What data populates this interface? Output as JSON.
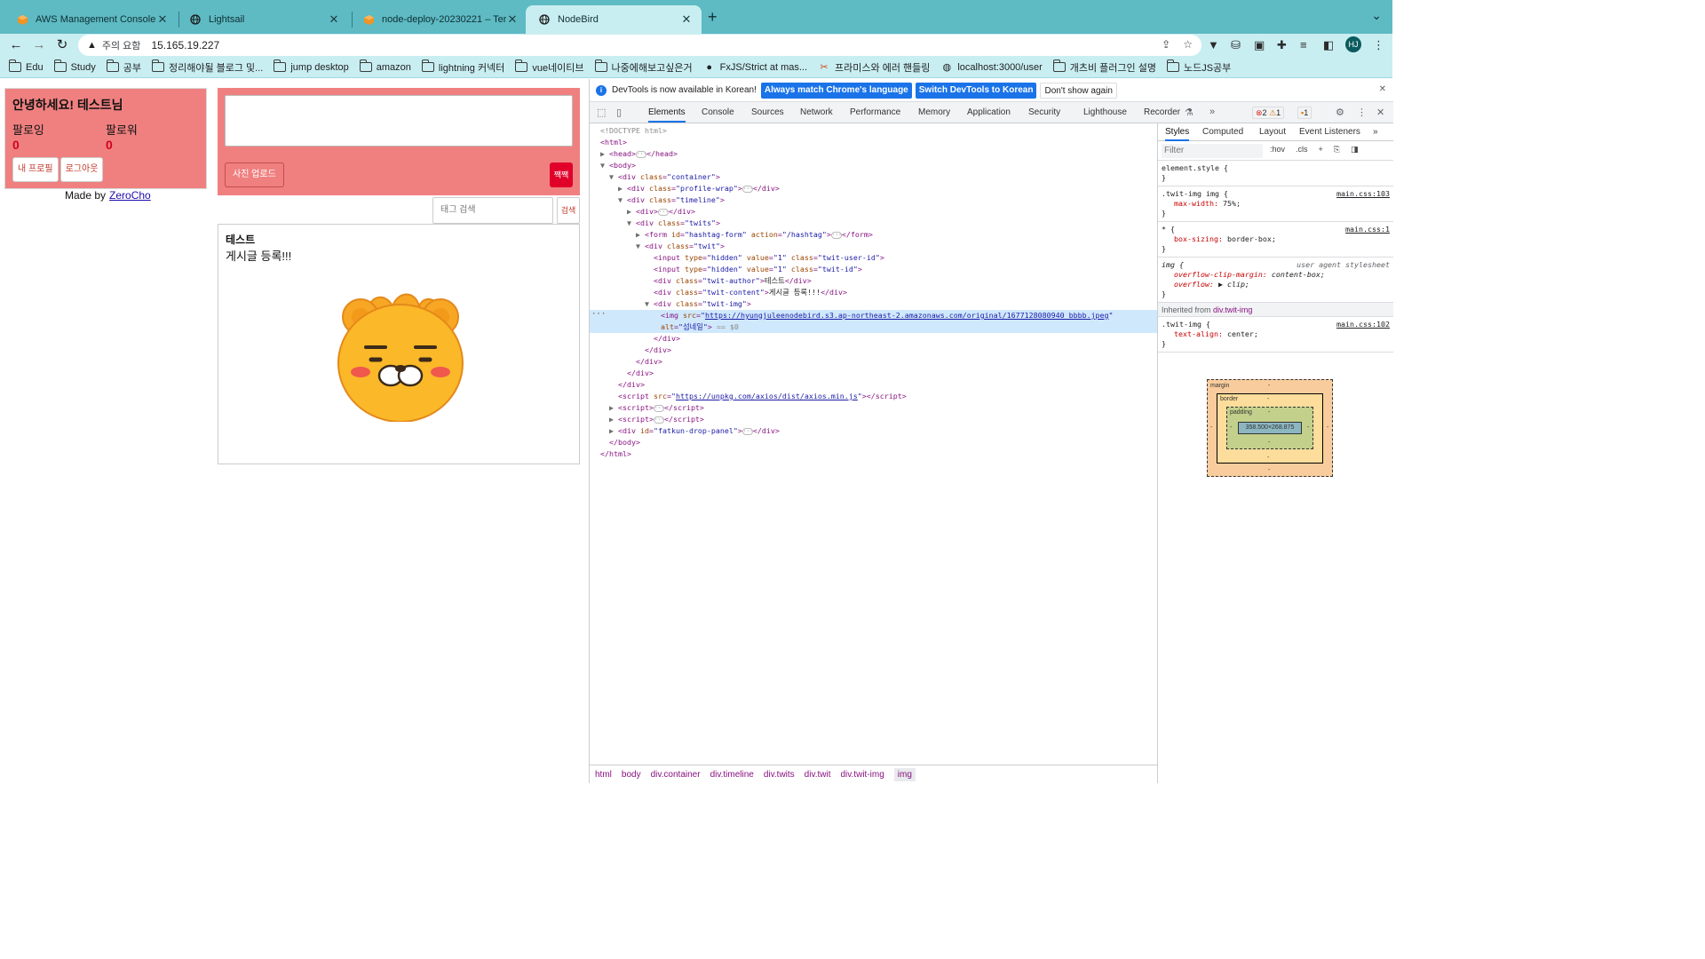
{
  "browser": {
    "tabs": [
      {
        "title": "AWS Management Console",
        "icon": "aws-cube-icon"
      },
      {
        "title": "Lightsail",
        "icon": "globe-icon"
      },
      {
        "title": "node-deploy-20230221 – Term",
        "icon": "aws-cube-icon"
      },
      {
        "title": "NodeBird",
        "icon": "globe-icon",
        "active": true
      }
    ],
    "omnibox": {
      "security_label": "주의 요함",
      "url": "15.165.19.227"
    },
    "avatar_initials": "HJ",
    "bookmarks": [
      {
        "label": "Edu",
        "icon": "folder-icon"
      },
      {
        "label": "Study",
        "icon": "folder-icon"
      },
      {
        "label": "공부",
        "icon": "folder-icon"
      },
      {
        "label": "정리해야될 블로그 및...",
        "icon": "folder-icon"
      },
      {
        "label": "jump desktop",
        "icon": "folder-icon"
      },
      {
        "label": "amazon",
        "icon": "folder-icon"
      },
      {
        "label": "lightning 커넥터",
        "icon": "folder-icon"
      },
      {
        "label": "vue네이티브",
        "icon": "folder-icon"
      },
      {
        "label": "나중에해보고싶은거",
        "icon": "folder-icon"
      },
      {
        "label": "FxJS/Strict at mas...",
        "icon": "github-icon"
      },
      {
        "label": "프라미스와 에러 핸들링",
        "icon": "javascript-icon"
      },
      {
        "label": "localhost:3000/user",
        "icon": "globe-icon"
      },
      {
        "label": "개츠비 플러그인 설명",
        "icon": "folder-icon"
      },
      {
        "label": "노드JS공부",
        "icon": "folder-icon"
      }
    ]
  },
  "page": {
    "greeting": "안녕하세요! 테스트님",
    "following_label": "팔로잉",
    "following_count": "0",
    "follower_label": "팔로워",
    "follower_count": "0",
    "my_profile_btn": "내 프로필",
    "logout_btn": "로그아웃",
    "made_by": "Made by",
    "made_by_link": "ZeroCho",
    "upload_btn": "사진 업로드",
    "tweet_btn": "짹짹",
    "tag_search_placeholder": "태그 검색",
    "tag_search_btn": "검색",
    "twit": {
      "author": "테스트",
      "content": "게시글 등록!!!"
    }
  },
  "devtools": {
    "infobar": {
      "text": "DevTools is now available in Korean!",
      "btn_match": "Always match Chrome's language",
      "btn_switch": "Switch DevTools to Korean",
      "btn_dismiss": "Don't show again"
    },
    "tabs": [
      "Elements",
      "Console",
      "Sources",
      "Network",
      "Performance",
      "Memory",
      "Application",
      "Security",
      "Lighthouse",
      "Recorder"
    ],
    "badges": {
      "errors": "2",
      "warnings": "1",
      "issues": "1"
    },
    "dom_text": {
      "doctype": "<!DOCTYPE html>",
      "twit_author_text": "테스트",
      "twit_content_text": "게시글 등록!!!",
      "img_src": "https://hyungjuleenodebird.s3.ap-northeast-2.amazonaws.com/original/1677128080940_bbbb.jpeg",
      "img_alt": "섬네일",
      "selected_marker": "== $0",
      "axios_src": "https://unpkg.com/axios/dist/axios.min.js"
    },
    "breadcrumbs": [
      "html",
      "body",
      "div.container",
      "div.timeline",
      "div.twits",
      "div.twit",
      "div.twit-img",
      "img"
    ],
    "styles": {
      "tabs": [
        "Styles",
        "Computed",
        "Layout",
        "Event Listeners"
      ],
      "filter_placeholder": "Filter",
      "hov": ":hov",
      "cls": ".cls",
      "rules": [
        {
          "selector": "element.style {",
          "source": "",
          "props": []
        },
        {
          "selector": ".twit-img img {",
          "source": "main.css:103",
          "props": [
            {
              "name": "max-width",
              "value": "75%;"
            }
          ]
        },
        {
          "selector": "* {",
          "source": "main.css:1",
          "props": [
            {
              "name": "box-sizing",
              "value": "border-box;"
            }
          ]
        },
        {
          "selector": "img {",
          "source": "user agent stylesheet",
          "props": [
            {
              "name": "overflow-clip-margin",
              "value": "content-box;"
            },
            {
              "name": "overflow",
              "value": "▶ clip;"
            }
          ]
        }
      ],
      "inherited_label": "Inherited from",
      "inherited_from": "div.twit-img",
      "inherited_rule": {
        "selector": ".twit-img {",
        "source": "main.css:102",
        "props": [
          {
            "name": "text-align",
            "value": "center;"
          }
        ]
      },
      "box_model": {
        "margin_label": "margin",
        "border_label": "border",
        "padding_label": "padding",
        "dash": "-",
        "content_size": "358.500×268.875"
      }
    }
  }
}
